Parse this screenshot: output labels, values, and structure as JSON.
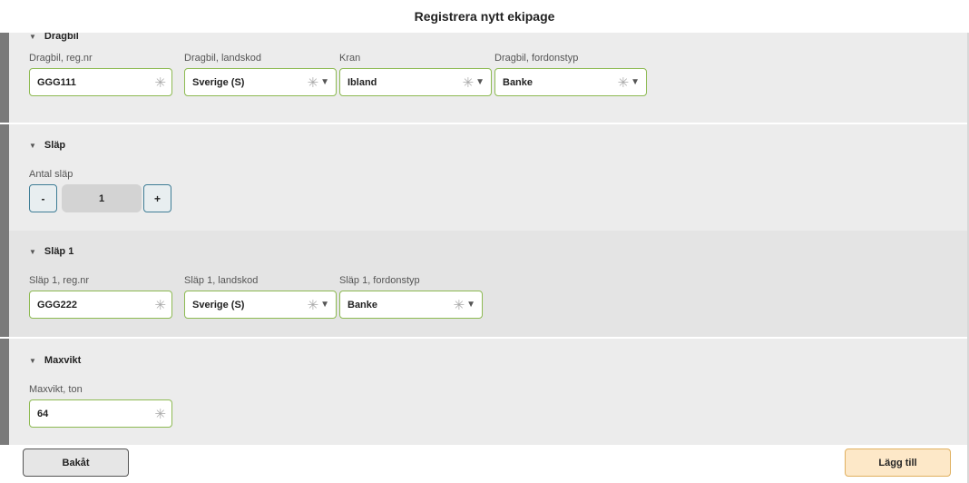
{
  "title": "Registrera nytt ekipage",
  "dragbil": {
    "header": "Dragbil",
    "regnr": {
      "label": "Dragbil, reg.nr",
      "value": "GGG111"
    },
    "landskod": {
      "label": "Dragbil, landskod",
      "value": "Sverige (S)"
    },
    "kran": {
      "label": "Kran",
      "value": "Ibland"
    },
    "fordonstyp": {
      "label": "Dragbil, fordonstyp",
      "value": "Banke"
    }
  },
  "slap": {
    "header": "Släp",
    "antal_label": "Antal släp",
    "minus": "-",
    "count": "1",
    "plus": "+"
  },
  "slap1": {
    "header": "Släp 1",
    "regnr": {
      "label": "Släp 1, reg.nr",
      "value": "GGG222"
    },
    "landskod": {
      "label": "Släp 1, landskod",
      "value": "Sverige (S)"
    },
    "fordonstyp": {
      "label": "Släp 1, fordonstyp",
      "value": "Banke"
    }
  },
  "maxvikt": {
    "header": "Maxvikt",
    "label": "Maxvikt, ton",
    "value": "64"
  },
  "icons": {
    "required": "✳",
    "collapse": "▼",
    "dropdown": "▼"
  },
  "footer": {
    "back_label": "Bakåt",
    "add_label": "Lägg till"
  },
  "colors": {
    "field_border": "#8dba52",
    "stepper_border": "#3f7d96",
    "add_bg": "#fde8c8",
    "section_bg": "#ececec",
    "accent_bar": "#7a7a7a"
  }
}
